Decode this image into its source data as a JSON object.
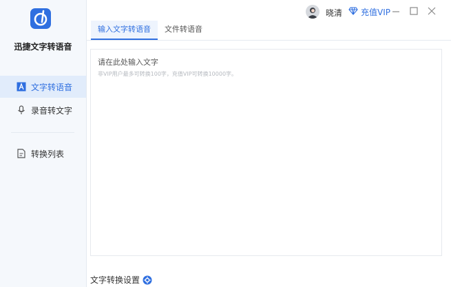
{
  "app": {
    "name": "迅捷文字转语音"
  },
  "sidebar": {
    "items": [
      {
        "label": "文字转语音",
        "icon": "text-a-icon",
        "active": true
      },
      {
        "label": "录音转文字",
        "icon": "microphone-icon",
        "active": false
      },
      {
        "label": "转换列表",
        "icon": "list-document-icon",
        "active": false
      }
    ]
  },
  "header": {
    "username": "晓清",
    "vip_label": "充值VIP"
  },
  "tabs": [
    {
      "label": "输入文字转语音",
      "active": true
    },
    {
      "label": "文件转语音",
      "active": false
    }
  ],
  "editor": {
    "placeholder": "请在此处输入文字",
    "hint": "非VIP用户最多可转换100字，充值VIP可转换10000字。"
  },
  "footer": {
    "settings_label": "文字转换设置"
  },
  "colors": {
    "accent": "#2f6fe0",
    "sidebar_bg": "#f5f8fc",
    "active_nav_bg": "#e1ecfb"
  }
}
